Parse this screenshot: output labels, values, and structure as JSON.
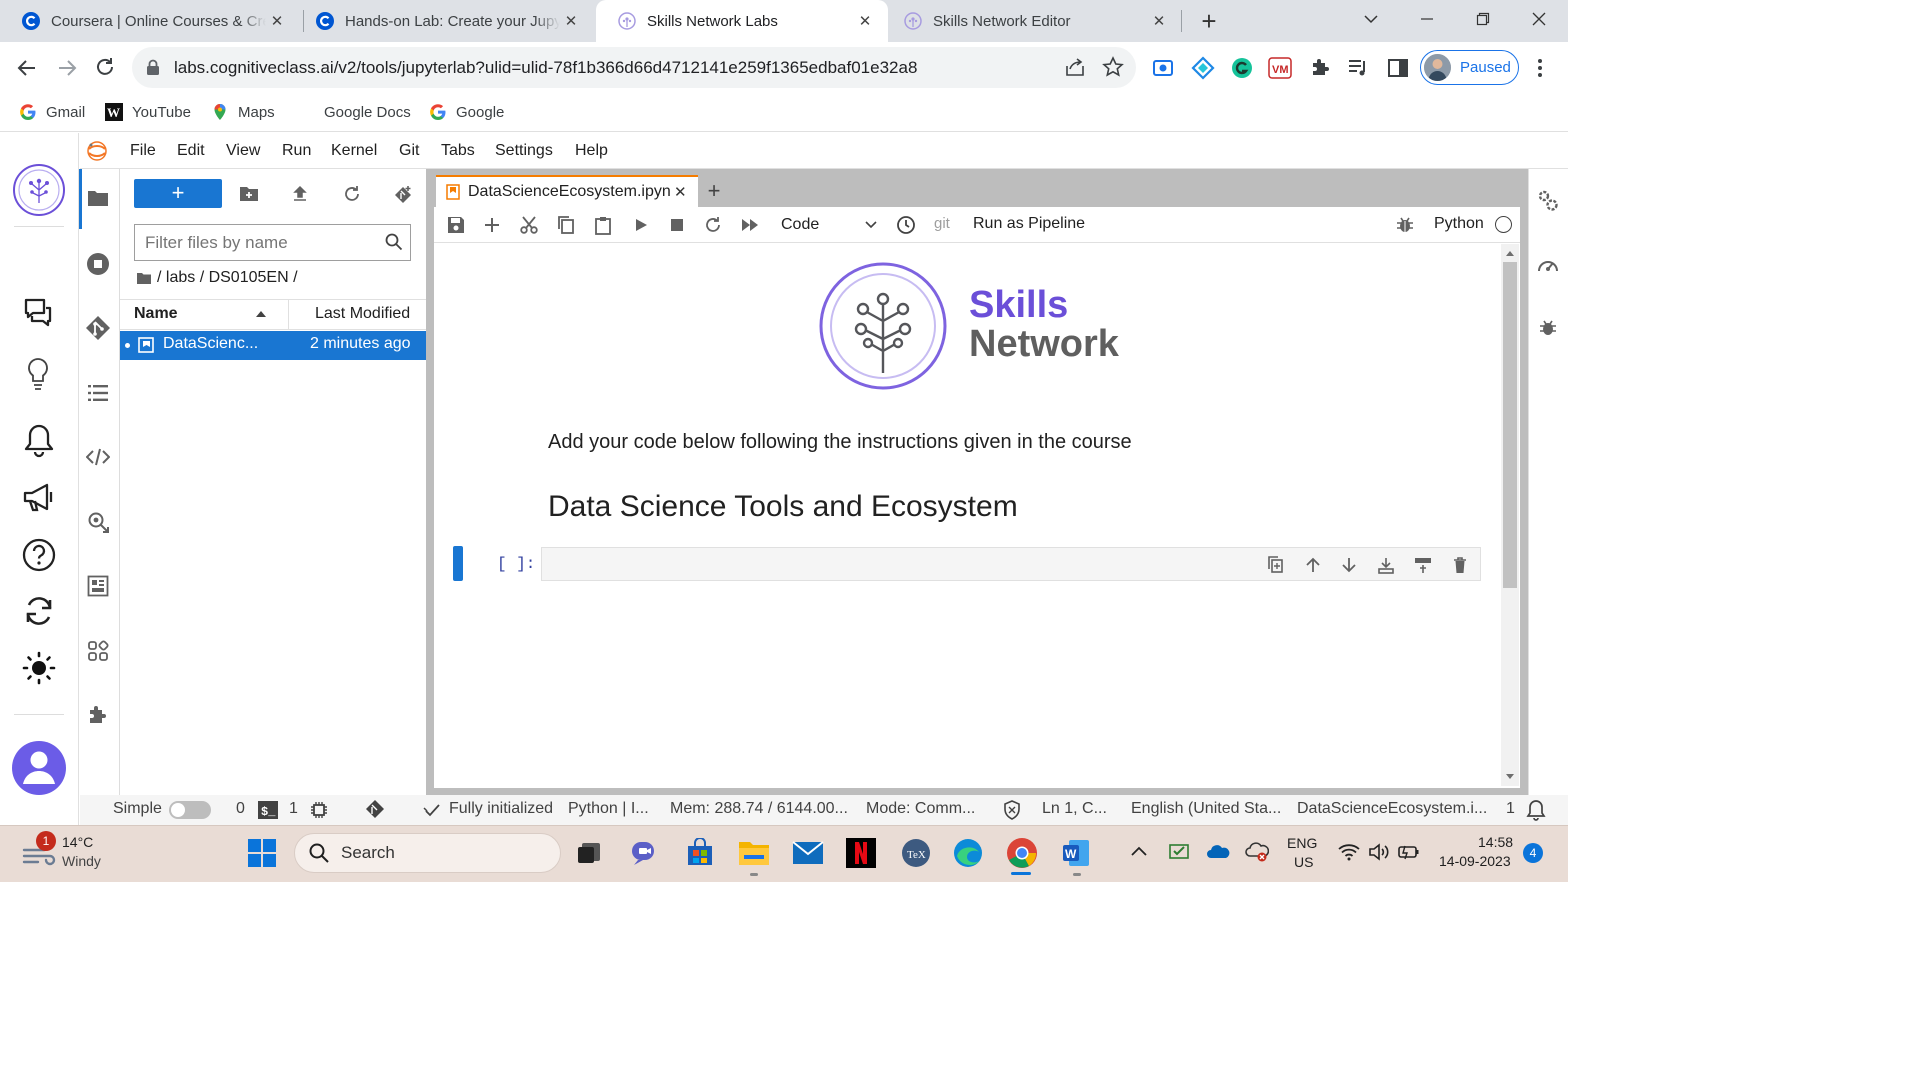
{
  "browser": {
    "tabs": [
      {
        "title": "Coursera | Online Courses & Credentials",
        "favicon": "coursera-icon",
        "active": false
      },
      {
        "title": "Hands-on Lab: Create your Jupyter Notebook",
        "favicon": "coursera-icon",
        "active": false
      },
      {
        "title": "Skills Network Labs",
        "favicon": "skills-network-icon",
        "active": true
      },
      {
        "title": "Skills Network Editor",
        "favicon": "skills-network-icon",
        "active": false
      }
    ],
    "new_tab": "+",
    "url": "labs.cognitiveclass.ai/v2/tools/jupyterlab?ulid=ulid-78f1b366d66d4712141e259f1365edbaf01e32a8",
    "profile_label": "Paused",
    "bookmarks": [
      {
        "label": "Gmail",
        "icon": "google-icon"
      },
      {
        "label": "YouTube",
        "icon": "w-icon"
      },
      {
        "label": "Maps",
        "icon": "maps-icon"
      },
      {
        "label": "Google Docs",
        "icon": ""
      },
      {
        "label": "Google",
        "icon": "google-icon"
      }
    ]
  },
  "jupyter": {
    "menu": [
      "File",
      "Edit",
      "View",
      "Run",
      "Kernel",
      "Git",
      "Tabs",
      "Settings",
      "Help"
    ],
    "new_button": "+",
    "filter_placeholder": "Filter files by name",
    "breadcrumb": "/ labs / DS0105EN /",
    "file_columns": {
      "name": "Name",
      "modified": "Last Modified"
    },
    "files": [
      {
        "name": "DataScienc...",
        "modified": "2 minutes ago",
        "selected": true
      }
    ],
    "notebook_tab": "DataScienceEcosystem.ipynb",
    "add_tab": "+",
    "cell_type": "Code",
    "git_label": "git",
    "pipeline_label": "Run as Pipeline",
    "kernel_name": "Python",
    "logo": {
      "line1": "Skills",
      "line2": "Network"
    },
    "markdown_text": "Add your code below following the instructions given in the course",
    "heading": "Data Science Tools and Ecosystem",
    "cell_prompt": "[ ]:",
    "status": {
      "mode_label": "Simple",
      "count0": "0",
      "count1": "1",
      "init": "Fully initialized",
      "kernel": "Python | I...",
      "mem": "Mem: 288.74 / 6144.00...",
      "mode": "Mode: Comm...",
      "position": "Ln 1, C...",
      "language": "English (United Sta...",
      "file": "DataScienceEcosystem.i...",
      "notifications": "1"
    }
  },
  "taskbar": {
    "weather_badge": "1",
    "temperature": "14°C",
    "weather": "Windy",
    "search_label": "Search",
    "lang1": "ENG",
    "lang2": "US",
    "time": "14:58",
    "date": "14-09-2023",
    "notif_count": "4"
  },
  "colors": {
    "accent": "#1976d2",
    "skills_purple": "#6b4fd8",
    "network_gray": "#5f5f5f",
    "notebook_tab_orange": "#f57c00",
    "taskbar_bg": "#e9dcd5"
  }
}
